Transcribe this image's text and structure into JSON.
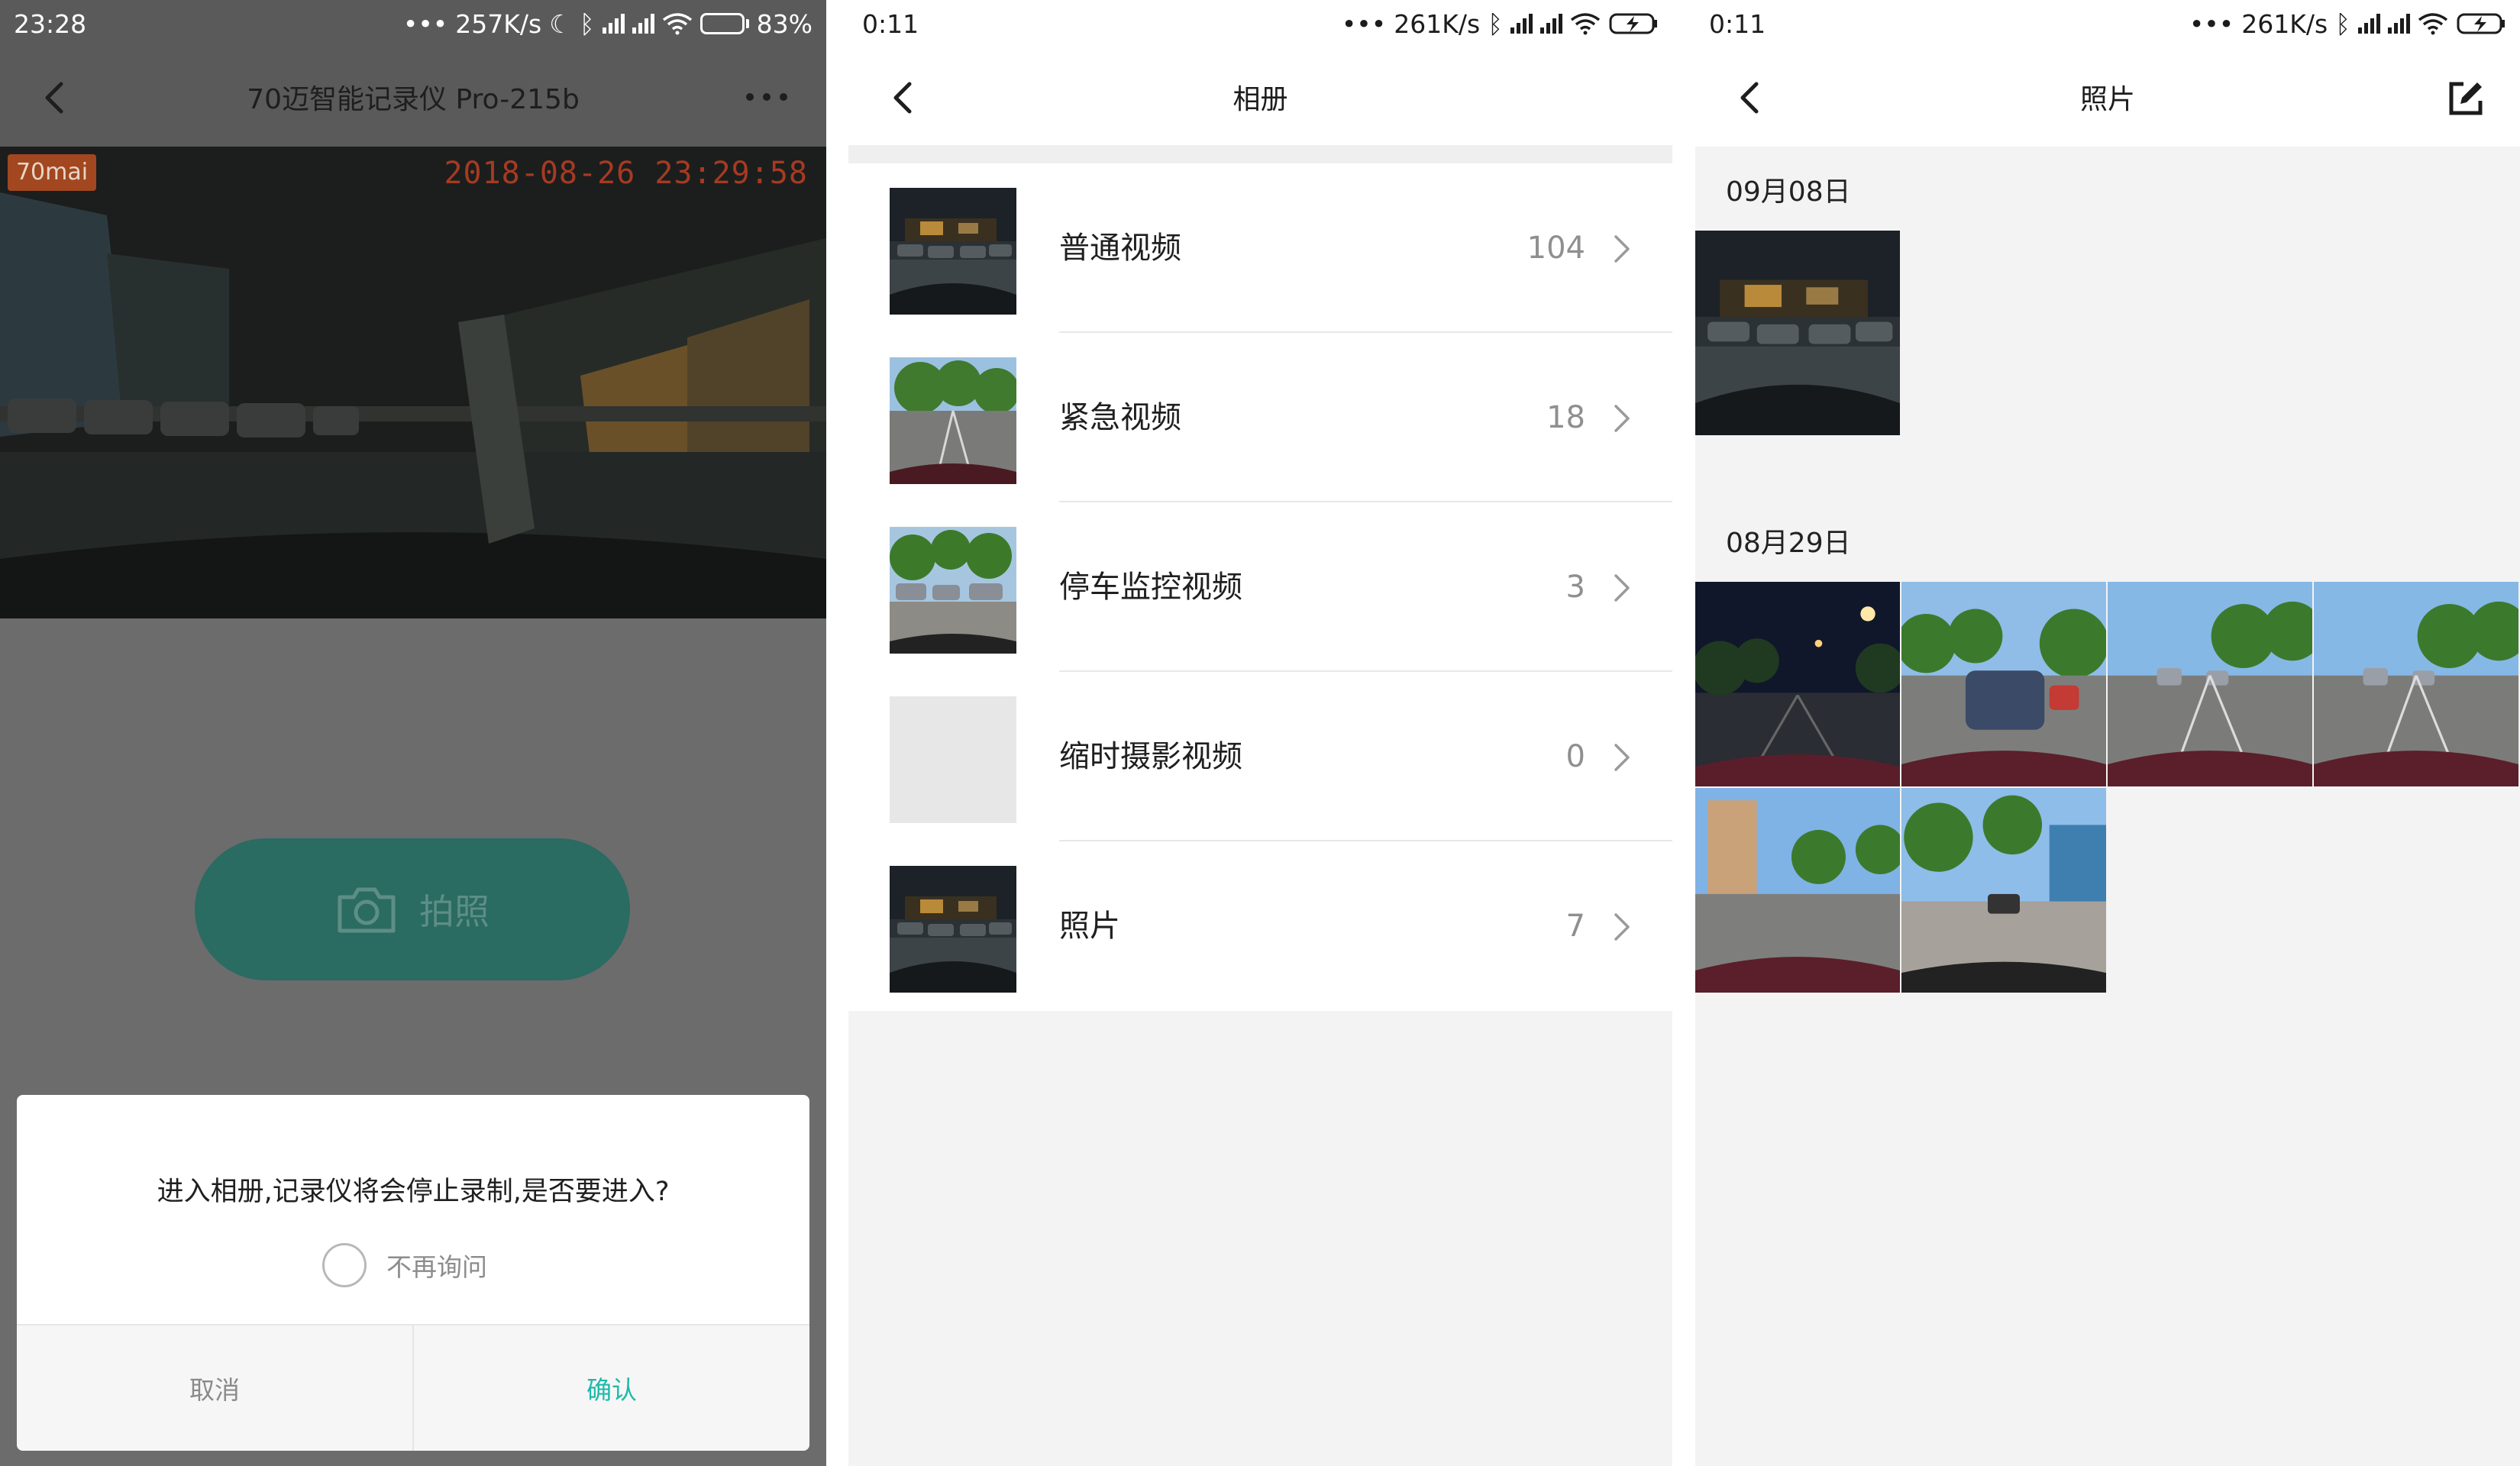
{
  "screens": [
    {
      "status": {
        "time": "23:28",
        "speed": "257K/s",
        "battery": "83%",
        "battery_level": 0.83
      },
      "nav": {
        "title": "70迈智能记录仪 Pro-215b",
        "back_icon": "chevron-left-icon",
        "more_icon": "more-dots-icon"
      },
      "preview": {
        "brand": "70mai",
        "timestamp": "2018-08-26 23:29:58",
        "expand_icon": "fullscreen-icon"
      },
      "capture_button": {
        "label": "拍照",
        "icon": "camera-icon"
      },
      "dialog": {
        "message": "进入相册,记录仪将会停止录制,是否要进入?",
        "checkbox_label": "不再询问",
        "checkbox_checked": false,
        "cancel_label": "取消",
        "confirm_label": "确认",
        "confirm_color": "#1fb9a9"
      }
    },
    {
      "status": {
        "time": "0:11",
        "speed": "261K/s"
      },
      "nav": {
        "title": "相册",
        "back_icon": "chevron-left-icon"
      },
      "albums": [
        {
          "name": "普通视频",
          "count": "104",
          "thumb": "night"
        },
        {
          "name": "紧急视频",
          "count": "18",
          "thumb": "road"
        },
        {
          "name": "停车监控视频",
          "count": "3",
          "thumb": "parking"
        },
        {
          "name": "缩时摄影视频",
          "count": "0",
          "thumb": "empty"
        },
        {
          "name": "照片",
          "count": "7",
          "thumb": "night"
        }
      ]
    },
    {
      "status": {
        "time": "0:11",
        "speed": "261K/s"
      },
      "nav": {
        "title": "照片",
        "back_icon": "chevron-left-icon",
        "edit_icon": "edit-icon"
      },
      "groups": [
        {
          "date": "09月08日",
          "photos": [
            "night"
          ]
        },
        {
          "date": "08月29日",
          "photos": [
            "night-street",
            "day-car",
            "day-road",
            "day-road",
            "day-building",
            "day-parking"
          ]
        }
      ]
    }
  ]
}
